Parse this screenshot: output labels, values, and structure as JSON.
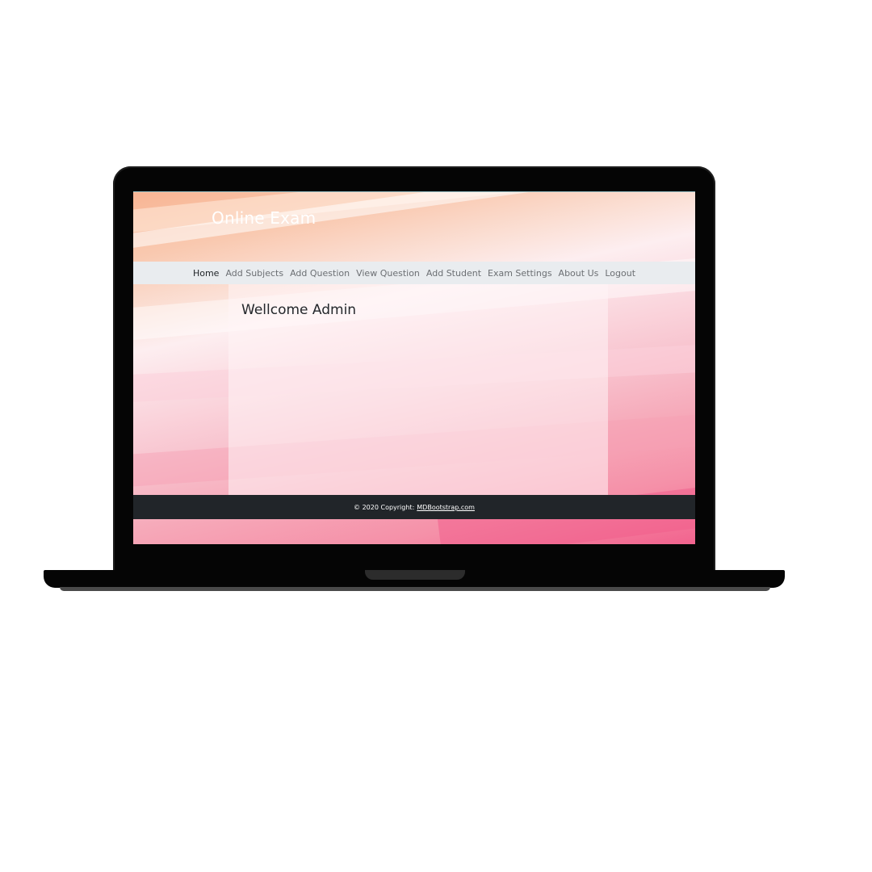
{
  "site": {
    "brand": "Online Exam"
  },
  "nav": {
    "items": [
      {
        "label": "Home",
        "active": true
      },
      {
        "label": "Add Subjects",
        "active": false
      },
      {
        "label": "Add Question",
        "active": false
      },
      {
        "label": "View Question",
        "active": false
      },
      {
        "label": "Add Student",
        "active": false
      },
      {
        "label": "Exam Settings",
        "active": false
      },
      {
        "label": "About Us",
        "active": false
      },
      {
        "label": "Logout",
        "active": false
      }
    ]
  },
  "main": {
    "heading": "Wellcome Admin"
  },
  "footer": {
    "copyright": "© 2020 Copyright:",
    "link_label": "MDBootstrap.com"
  },
  "colors": {
    "navbar_bg": "#e9ecef",
    "footer_bg": "#212529",
    "laptop_frame": "#050505"
  }
}
